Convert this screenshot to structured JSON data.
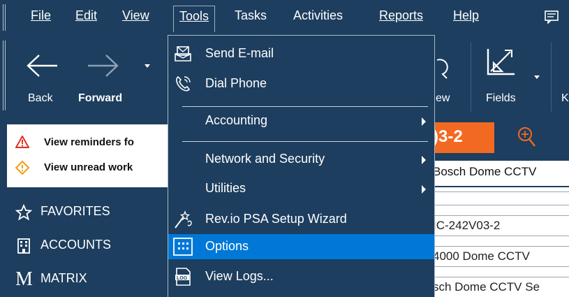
{
  "menubar": {
    "items": [
      {
        "label": "File"
      },
      {
        "label": "Edit"
      },
      {
        "label": "View"
      },
      {
        "label": "Tools"
      },
      {
        "label": "Tasks"
      },
      {
        "label": "Activities"
      },
      {
        "label": "Reports"
      },
      {
        "label": "Help"
      }
    ],
    "active": "Tools",
    "right_icon": "message-icon"
  },
  "toolbar": {
    "back_label": "Back",
    "forward_label": "Forward",
    "view_label_partial": "ew",
    "fields_label": "Fields",
    "cutoff_label": "K"
  },
  "notifications": {
    "items": [
      {
        "icon": "warning-triangle-icon",
        "text": "View reminders fo"
      },
      {
        "icon": "info-diamond-icon",
        "text": "View unread work"
      }
    ]
  },
  "nav": {
    "items": [
      {
        "icon": "star-icon",
        "label": "FAVORITES"
      },
      {
        "icon": "building-icon",
        "label": "ACCOUNTS"
      },
      {
        "icon": "m-letter-icon",
        "label": "MATRIX"
      }
    ]
  },
  "record": {
    "id_partial": ")3-2",
    "name_partial": "Bosch Dome CCTV",
    "fields": [
      {
        "value": "",
        "placeholder": ""
      },
      {
        "value": "IC-242V03-2"
      },
      {
        "value": "4000 Dome CCTV"
      },
      {
        "value": "sch Dome CCTV Se"
      }
    ]
  },
  "tools_menu": {
    "items": [
      {
        "type": "item",
        "icon": "envelope-icon",
        "label": "Send E-mail",
        "submenu": false
      },
      {
        "type": "item",
        "icon": "phone-icon",
        "label": "Dial Phone",
        "submenu": false
      },
      {
        "type": "separator"
      },
      {
        "type": "item",
        "icon": "",
        "label": "Accounting",
        "submenu": true
      },
      {
        "type": "separator"
      },
      {
        "type": "item",
        "icon": "",
        "label": "Network and Security",
        "submenu": true
      },
      {
        "type": "item",
        "icon": "",
        "label": "Utilities",
        "submenu": true
      },
      {
        "type": "item",
        "icon": "wizard-icon",
        "label": "Rev.io PSA Setup Wizard",
        "submenu": false
      },
      {
        "type": "item",
        "icon": "options-icon",
        "label": "Options",
        "submenu": false,
        "highlighted": true
      },
      {
        "type": "item",
        "icon": "log-icon",
        "label": "View Logs...",
        "submenu": false
      }
    ]
  },
  "colors": {
    "background": "#1d3e5e",
    "highlight": "#0078d7",
    "record_id_bg": "#f26a22",
    "warning": "#e0301e",
    "info": "#f39c12"
  }
}
